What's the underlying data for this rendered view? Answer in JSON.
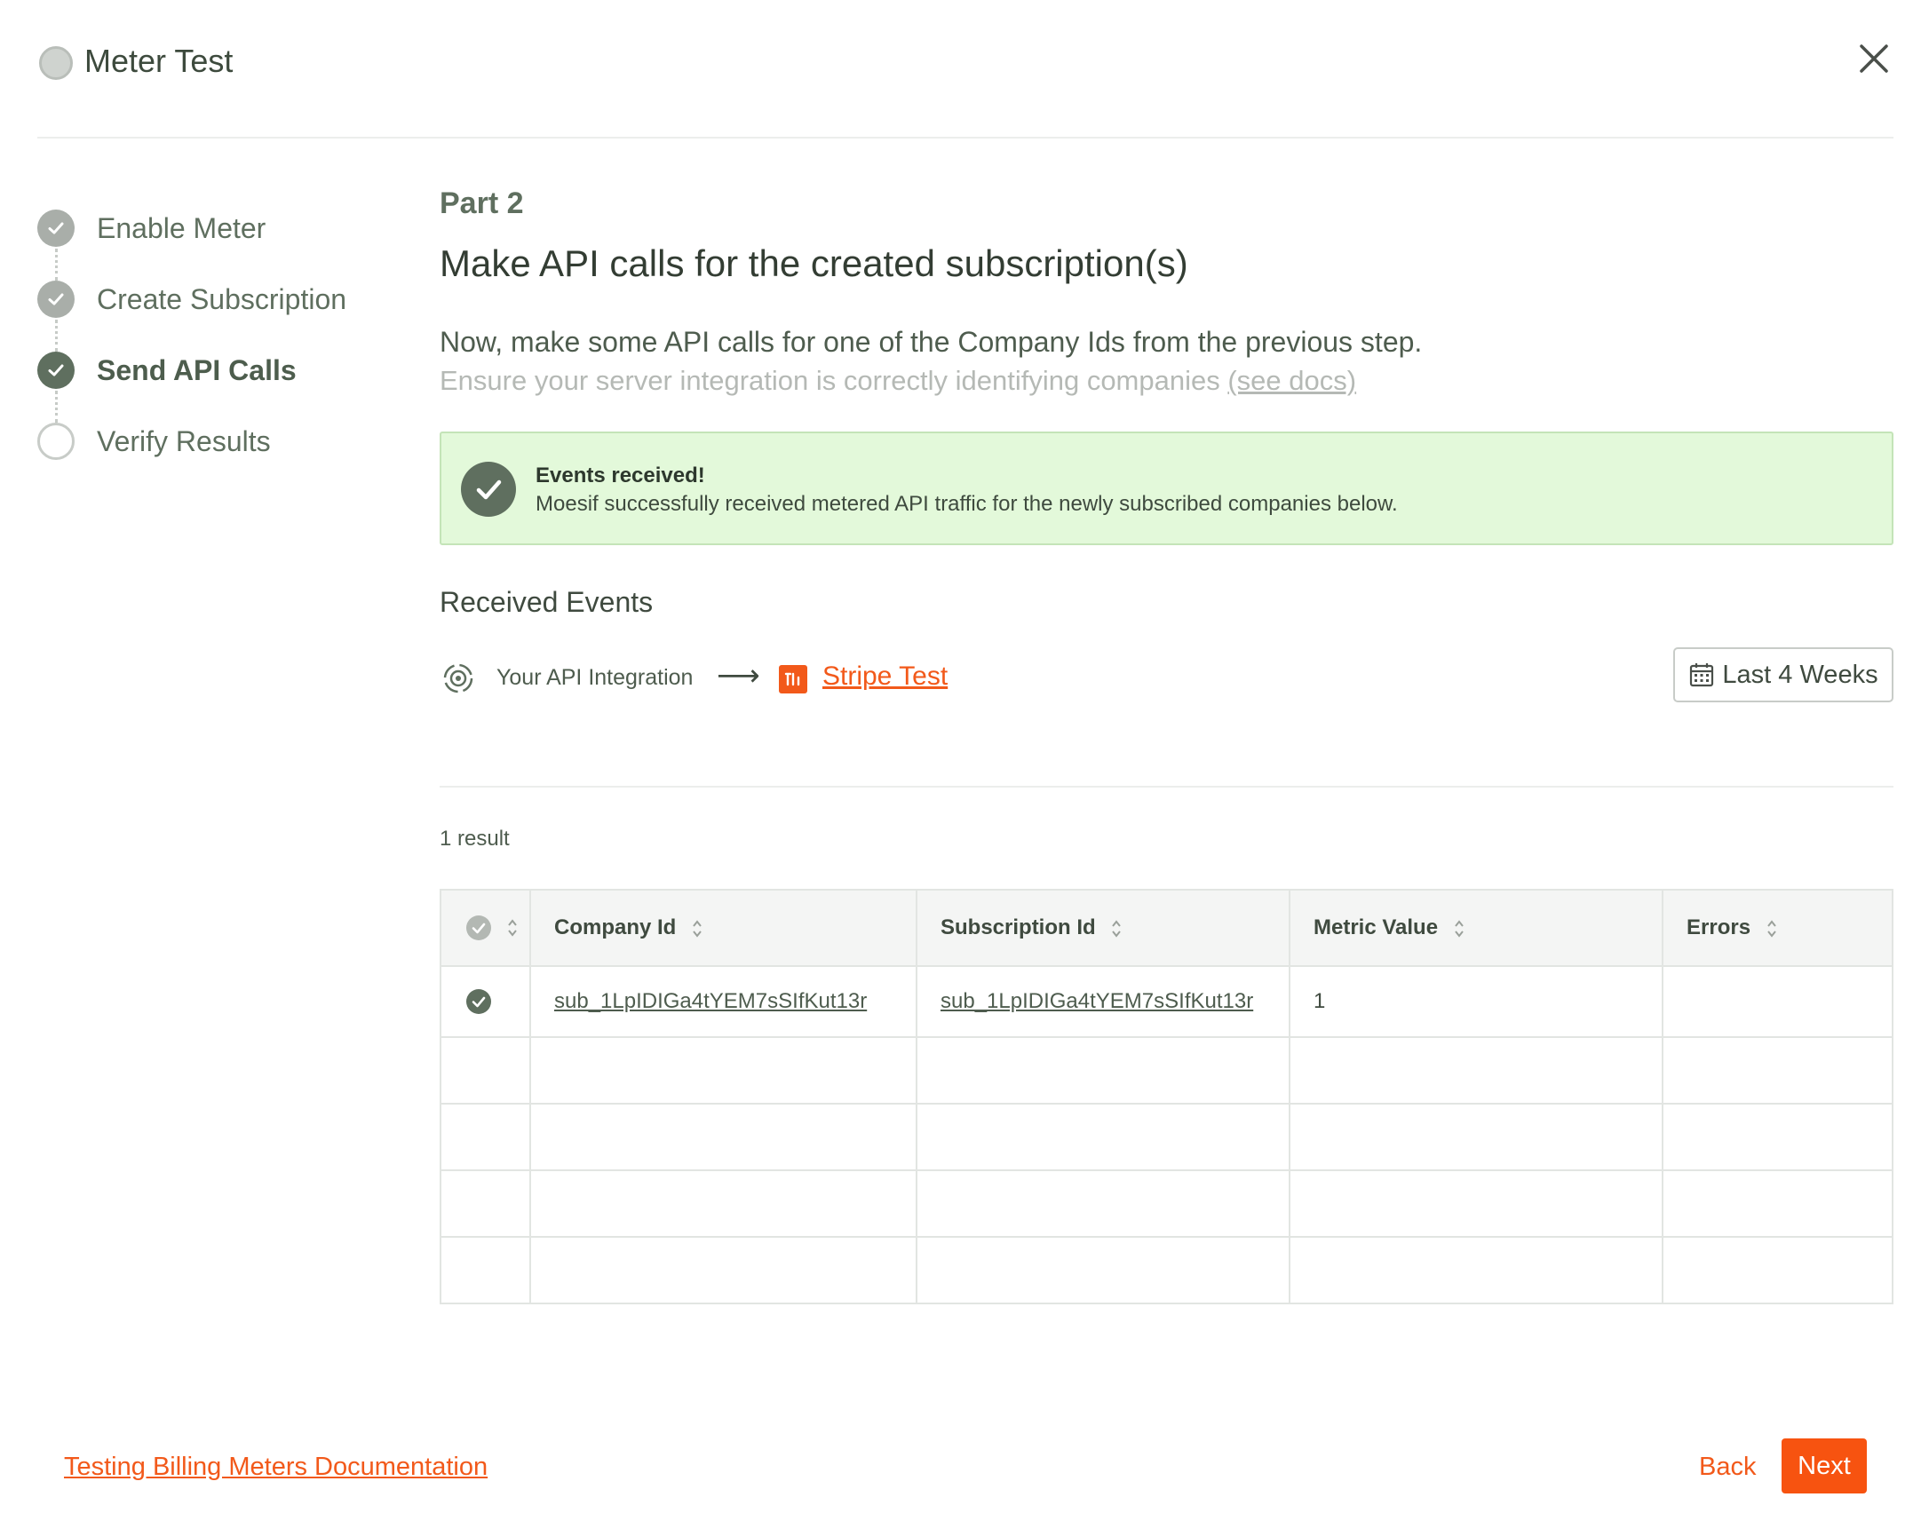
{
  "header": {
    "title": "Meter Test"
  },
  "stepper": {
    "steps": [
      {
        "label": "Enable Meter",
        "state": "done"
      },
      {
        "label": "Create Subscription",
        "state": "done"
      },
      {
        "label": "Send API Calls",
        "state": "current"
      },
      {
        "label": "Verify Results",
        "state": "todo"
      }
    ]
  },
  "main": {
    "part": "Part 2",
    "heading": "Make API calls for the created subscription(s)",
    "lead": "Now, make some API calls for one of the Company Ids from the previous step.",
    "sub_text": "Ensure your server integration is correctly identifying companies ",
    "sub_link": "(see docs)",
    "alert": {
      "title": "Events received!",
      "text": "Moesif successfully received metered API traffic for the newly subscribed companies below."
    },
    "received_events_title": "Received Events",
    "flow": {
      "source_label": "Your API Integration",
      "arrow": "⟶",
      "target_label": "Stripe Test"
    },
    "date_range": "Last 4 Weeks",
    "result_count": "1 result",
    "table": {
      "columns": [
        "Company Id",
        "Subscription Id",
        "Metric Value",
        "Errors"
      ],
      "rows": [
        [
          "sub_1LpIDIGa4tYEM7sSIfKut13r",
          "sub_1LpIDIGa4tYEM7sSIfKut13r",
          "1",
          ""
        ]
      ]
    }
  },
  "footer": {
    "doc_link": "Testing Billing Meters Documentation",
    "back": "Back",
    "next": "Next"
  },
  "colors": {
    "accent": "#f2591a",
    "step_current": "#5f6f5f",
    "alert_bg": "#e3f9da"
  }
}
